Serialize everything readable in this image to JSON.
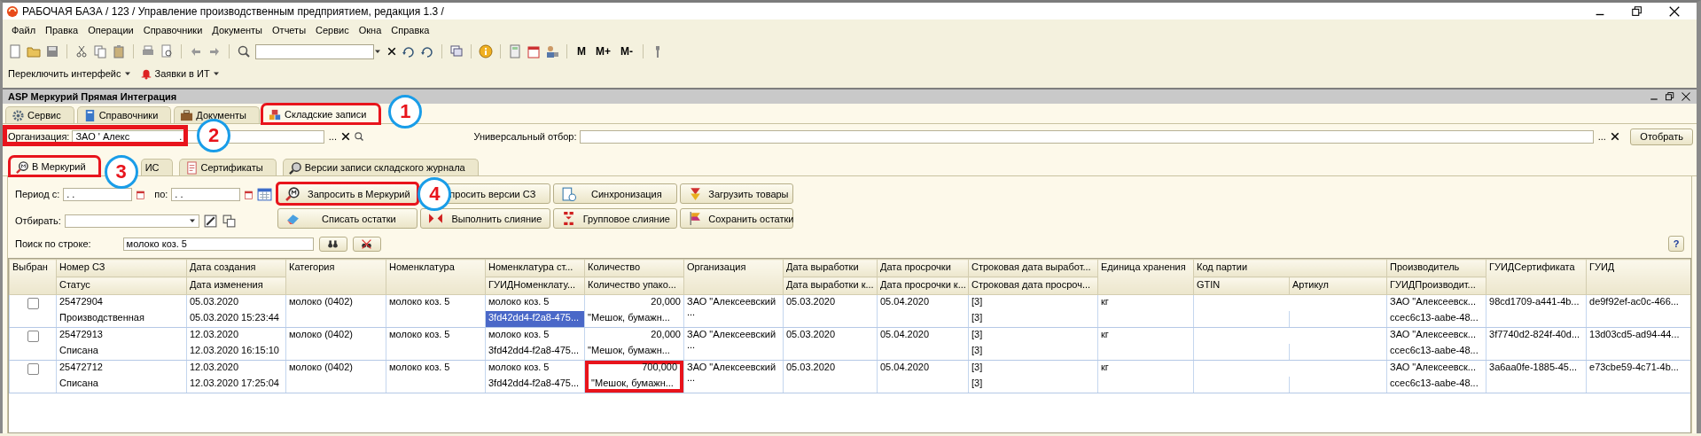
{
  "app_window": {
    "title": "РАБОЧАЯ БАЗА / 123 /  Управление производственным предприятием, редакция 1.3 /"
  },
  "menu": [
    "Файл",
    "Правка",
    "Операции",
    "Справочники",
    "Документы",
    "Отчеты",
    "Сервис",
    "Окна",
    "Справка"
  ],
  "toolbar": {
    "memory_buttons": [
      "M",
      "M+",
      "M-"
    ]
  },
  "panel_bar": {
    "buttons": [
      "Переключить интерфейс",
      "Заявки в ИТ"
    ]
  },
  "form": {
    "title": "ASP Меркурий Прямая Интеграция",
    "tabs": [
      {
        "label": "Сервис",
        "selected": false,
        "highlighted": false
      },
      {
        "label": "Справочники",
        "selected": false,
        "highlighted": false
      },
      {
        "label": "Документы",
        "selected": false,
        "highlighted": false
      },
      {
        "label": "Складские записи",
        "selected": true,
        "highlighted": true,
        "callout": "1"
      }
    ],
    "organization": {
      "label": "Организация:",
      "value": "ЗАО ' Алекс",
      "trailing": ".",
      "select_button": "...",
      "highlighted": true,
      "callout": "2"
    },
    "universal_filter": {
      "label": "Универсальный отбор:",
      "select_button": "..."
    },
    "filter_button": "Отобрать",
    "subtabs": [
      {
        "label": "В Меркурий",
        "selected": true,
        "highlighted": true,
        "callout": "3"
      },
      {
        "label": "ИС",
        "selected": false,
        "highlighted": false
      },
      {
        "label": "Сертификаты",
        "selected": false,
        "highlighted": false
      },
      {
        "label": "Версии записи складского журнала",
        "selected": false,
        "highlighted": false
      }
    ],
    "period": {
      "from_label": "Период с:",
      "from_value": ". .",
      "to_label": "по:",
      "to_value": ". ."
    },
    "select_label": "Отбирать:",
    "actions": [
      {
        "label": "Запросить в Меркурий",
        "highlighted": true,
        "callout": "4"
      },
      {
        "label": "просить версии СЗ",
        "highlighted": false
      },
      {
        "label": "Синхронизация",
        "highlighted": false
      },
      {
        "label": "Загрузить товары",
        "highlighted": false
      },
      {
        "label": "Списать остатки",
        "highlighted": false
      },
      {
        "label": "Выполнить слияние",
        "highlighted": false
      },
      {
        "label": "Групповое слияние",
        "highlighted": false
      },
      {
        "label": "Сохранить остатки",
        "highlighted": false
      }
    ],
    "search": {
      "label": "Поиск по строке:",
      "value": "молоко коз. 5"
    },
    "help": "?",
    "table": {
      "columns": [
        {
          "top": "Выбран"
        },
        {
          "top": "Номер СЗ",
          "bottom": "Статус"
        },
        {
          "top": "Дата создания",
          "bottom": "Дата изменения"
        },
        {
          "top": "Категория"
        },
        {
          "top": "Номенклатура"
        },
        {
          "top": "Номенклатура ст...",
          "bottom": "ГУИДНоменклату..."
        },
        {
          "top": "Количество",
          "bottom": "Количество упако..."
        },
        {
          "top": "Организация"
        },
        {
          "top": "Дата выработки",
          "bottom": "Дата выработки к..."
        },
        {
          "top": "Дата просрочки",
          "bottom": "Дата просрочки к..."
        },
        {
          "top": "Строковая дата выработ...",
          "bottom": "Строковая дата просроч..."
        },
        {
          "top": "Единица хранения"
        },
        {
          "top": "Код партии",
          "bottom_parts": [
            "GTIN",
            "Артикул"
          ]
        },
        {
          "top": "Производитель",
          "bottom": "ГУИДПроизводит..."
        },
        {
          "top": "ГУИДСертификата"
        },
        {
          "top": "ГУИД"
        }
      ],
      "rows": [
        {
          "checked": false,
          "number": "25472904",
          "status": "Производственная",
          "created": "05.03.2020",
          "changed": "05.03.2020 15:23:44",
          "category": "молоко (0402)",
          "nomenclature": "молоко коз. 5",
          "nomenclature_std": "молоко коз. 5",
          "guid_nomenclature": "3fd42dd4-f2a8-475...",
          "guid_nomenclature_selected": true,
          "quantity": "20,000",
          "packaging": "\"Мешок, бумажн...",
          "quantity_highlighted": false,
          "organization": "ЗАО \"Алексеевский ...",
          "production_date": "05.03.2020",
          "expiry_date": "05.04.2020",
          "string_production_date": "[3]",
          "string_expiry_date": "[3]",
          "unit": "кг",
          "producer": "ЗАО \"Алексеевск...",
          "producer_guid": "ccec6c13-aabe-48...",
          "certificate_guid": "98cd1709-a441-4b...",
          "guid": "de9f92ef-ac0c-466..."
        },
        {
          "checked": false,
          "number": "25472913",
          "status": "Списана",
          "created": "12.03.2020",
          "changed": "12.03.2020 16:15:10",
          "category": "молоко (0402)",
          "nomenclature": "молоко коз. 5",
          "nomenclature_std": "молоко коз. 5",
          "guid_nomenclature": "3fd42dd4-f2a8-475...",
          "guid_nomenclature_selected": false,
          "quantity": "20,000",
          "packaging": "\"Мешок, бумажн...",
          "quantity_highlighted": false,
          "organization": "ЗАО \"Алексеевский ...",
          "production_date": "05.03.2020",
          "expiry_date": "05.04.2020",
          "string_production_date": "[3]",
          "string_expiry_date": "[3]",
          "unit": "кг",
          "producer": "ЗАО \"Алексеевск...",
          "producer_guid": "ccec6c13-aabe-48...",
          "certificate_guid": "3f7740d2-824f-40d...",
          "guid": "13d03cd5-ad94-44..."
        },
        {
          "checked": false,
          "number": "25472712",
          "status": "Списана",
          "created": "12.03.2020",
          "changed": "12.03.2020 17:25:04",
          "category": "молоко (0402)",
          "nomenclature": "молоко коз. 5",
          "nomenclature_std": "молоко коз. 5",
          "guid_nomenclature": "3fd42dd4-f2a8-475...",
          "guid_nomenclature_selected": false,
          "quantity": "700,000",
          "packaging": "\"Мешок, бумажн...",
          "quantity_highlighted": true,
          "organization": "ЗАО \"Алексеевский ...",
          "production_date": "05.03.2020",
          "expiry_date": "05.04.2020",
          "string_production_date": "[3]",
          "string_expiry_date": "[3]",
          "unit": "кг",
          "producer": "ЗАО \"Алексеевск...",
          "producer_guid": "ccec6c13-aabe-48...",
          "certificate_guid": "3a6aa0fe-1885-45...",
          "guid": "e73cbe59-4c71-4b..."
        }
      ]
    }
  }
}
